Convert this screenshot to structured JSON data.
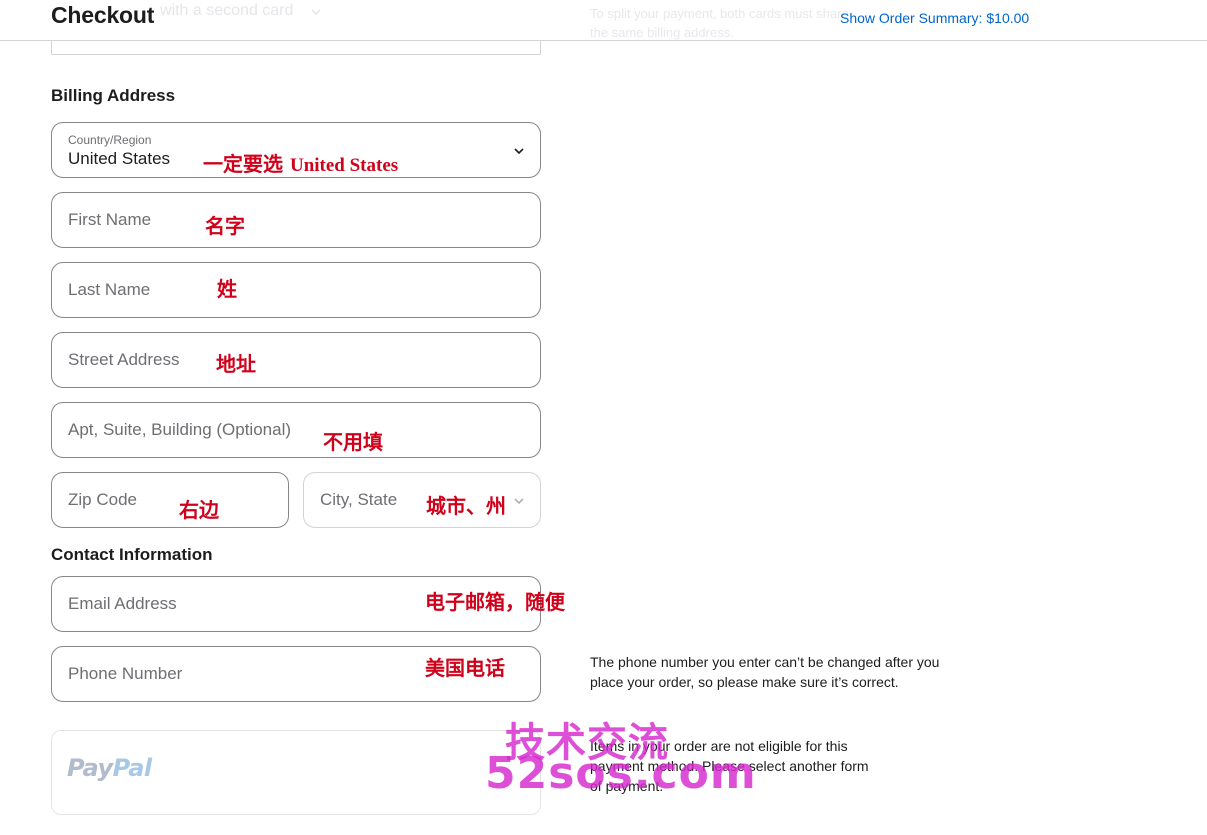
{
  "header": {
    "title": "Checkout",
    "second_card_ghost": "with a second card",
    "split_note_ghost": "To split your payment, both cards must share the same billing address.",
    "order_summary_label": "Show Order Summary:",
    "order_summary_amount": "$10.00"
  },
  "billing": {
    "heading": "Billing Address",
    "country": {
      "label": "Country/Region",
      "value": "United States",
      "icon": "chevron-down-icon"
    },
    "first_name": {
      "placeholder": "First Name"
    },
    "last_name": {
      "placeholder": "Last Name"
    },
    "street": {
      "placeholder": "Street Address"
    },
    "apt": {
      "placeholder": "Apt, Suite, Building (Optional)"
    },
    "zip": {
      "placeholder": "Zip Code"
    },
    "city_state": {
      "placeholder": "City, State",
      "icon": "chevron-down-icon"
    }
  },
  "contact": {
    "heading": "Contact Information",
    "email": {
      "placeholder": "Email Address"
    },
    "phone": {
      "placeholder": "Phone Number"
    },
    "phone_note": "The phone number you enter can’t be changed after you place your order, so please make sure it’s correct."
  },
  "payment": {
    "paypal_logo_part1": "Pay",
    "paypal_logo_part2": "Pal",
    "ineligible_note": "Items in your order are not eligible for this payment method. Please select another form of payment."
  },
  "annotations": {
    "country_cn": "一定要选",
    "country_en": "United States",
    "first_name": "名字",
    "last_name": "姓",
    "street": "地址",
    "apt": "不用填",
    "zip": "右边",
    "city_state": "城市、州",
    "email": "电子邮箱，随便",
    "phone": "美国电话"
  },
  "watermark": {
    "line1": "技术交流",
    "line2": "52sos.com"
  },
  "colors": {
    "link": "#0066cc",
    "annotation": "#d0021b",
    "watermark": "#d628cd",
    "border": "#86868b"
  }
}
